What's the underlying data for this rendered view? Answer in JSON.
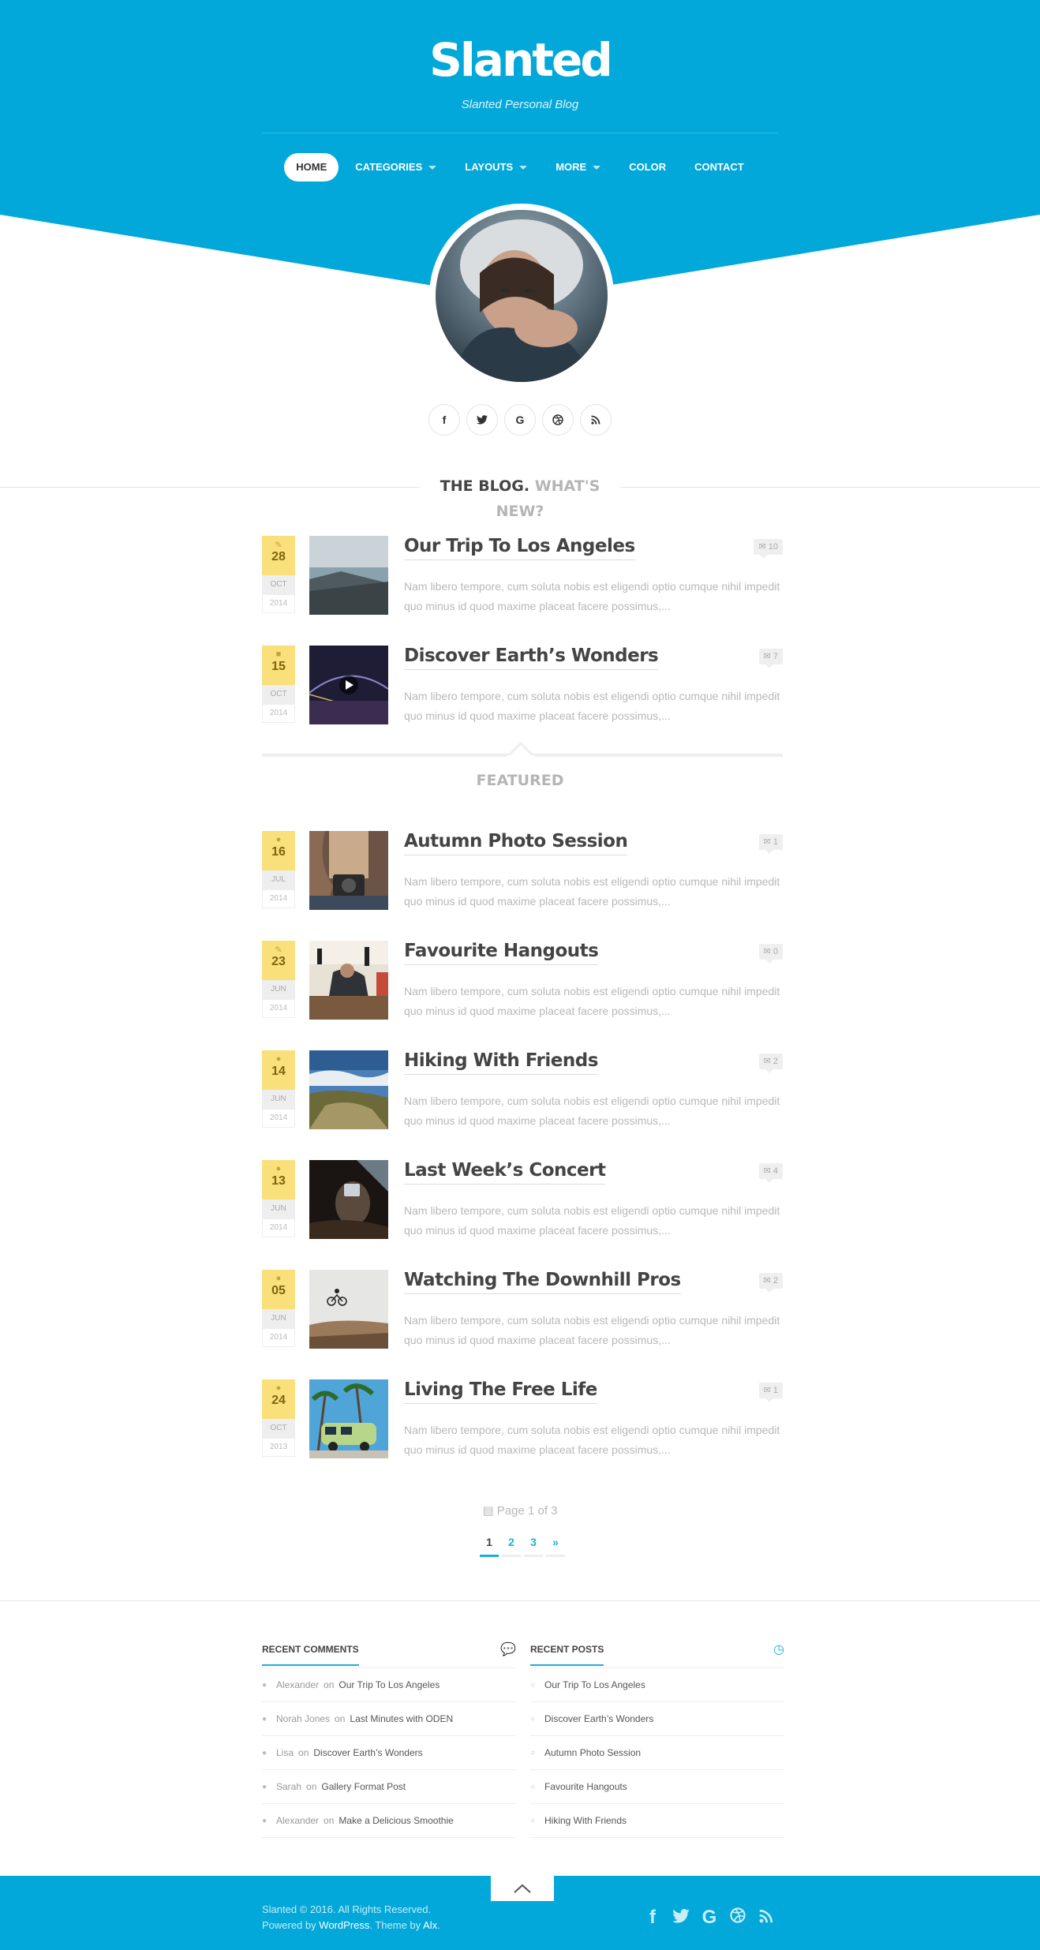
{
  "site": {
    "title": "Slanted",
    "description": "Slanted Personal Blog",
    "accent_color": "#02a8d9",
    "date_badge_color": "#f9e07a"
  },
  "nav": {
    "items": [
      {
        "label": "HOME",
        "active": true,
        "has_dropdown": false
      },
      {
        "label": "CATEGORIES",
        "active": false,
        "has_dropdown": true
      },
      {
        "label": "LAYOUTS",
        "active": false,
        "has_dropdown": true
      },
      {
        "label": "MORE",
        "active": false,
        "has_dropdown": true
      },
      {
        "label": "COLOR",
        "active": false,
        "has_dropdown": false
      },
      {
        "label": "CONTACT",
        "active": false,
        "has_dropdown": false
      }
    ]
  },
  "social": [
    "facebook-icon",
    "twitter-icon",
    "google-icon",
    "dribbble-icon",
    "rss-icon"
  ],
  "blog_heading": {
    "part1": "THE BLOG.",
    "part2": "WHAT'S NEW?"
  },
  "featured_label": "FEATURED",
  "posts": [
    {
      "day": "28",
      "month": "OCT",
      "year": "2014",
      "format_icon": "pencil-icon",
      "title": "Our Trip To Los Angeles",
      "comments": "10",
      "excerpt": "Nam libero tempore, cum soluta nobis est eligendi optio cumque nihil impedit quo minus id quod maxime placeat facere possimus,..."
    },
    {
      "day": "15",
      "month": "OCT",
      "year": "2014",
      "format_icon": "video-icon",
      "title": "Discover Earth’s Wonders",
      "comments": "7",
      "excerpt": "Nam libero tempore, cum soluta nobis est eligendi optio cumque nihil impedit quo minus id quod maxime placeat facere possimus,..."
    },
    {
      "day": "16",
      "month": "JUL",
      "year": "2014",
      "format_icon": "camera-icon",
      "title": "Autumn Photo Session",
      "comments": "1",
      "excerpt": "Nam libero tempore, cum soluta nobis est eligendi optio cumque nihil impedit quo minus id quod maxime placeat facere possimus,..."
    },
    {
      "day": "23",
      "month": "JUN",
      "year": "2014",
      "format_icon": "pencil-icon",
      "title": "Favourite Hangouts",
      "comments": "0",
      "excerpt": "Nam libero tempore, cum soluta nobis est eligendi optio cumque nihil impedit quo minus id quod maxime placeat facere possimus,..."
    },
    {
      "day": "14",
      "month": "JUN",
      "year": "2014",
      "format_icon": "camera-icon",
      "title": "Hiking With Friends",
      "comments": "2",
      "excerpt": "Nam libero tempore, cum soluta nobis est eligendi optio cumque nihil impedit quo minus id quod maxime placeat facere possimus,..."
    },
    {
      "day": "13",
      "month": "JUN",
      "year": "2014",
      "format_icon": "camera-icon",
      "title": "Last Week’s Concert",
      "comments": "4",
      "excerpt": "Nam libero tempore, cum soluta nobis est eligendi optio cumque nihil impedit quo minus id quod maxime placeat facere possimus,..."
    },
    {
      "day": "05",
      "month": "JUN",
      "year": "2014",
      "format_icon": "camera-icon",
      "title": "Watching The Downhill Pros",
      "comments": "2",
      "excerpt": "Nam libero tempore, cum soluta nobis est eligendi optio cumque nihil impedit quo minus id quod maxime placeat facere possimus,..."
    },
    {
      "day": "24",
      "month": "OCT",
      "year": "2013",
      "format_icon": "camera-icon",
      "title": "Living The Free Life",
      "comments": "1",
      "excerpt": "Nam libero tempore, cum soluta nobis est eligendi optio cumque nihil impedit quo minus id quod maxime placeat facere possimus,..."
    }
  ],
  "pagination": {
    "info": "Page 1 of 3",
    "pages": [
      "1",
      "2",
      "3",
      "»"
    ]
  },
  "recent_comments": {
    "title": "RECENT COMMENTS",
    "items": [
      {
        "author": "Alexander",
        "on": "on",
        "post": "Our Trip To Los Angeles"
      },
      {
        "author": "Norah Jones",
        "on": "on",
        "post": "Last Minutes with ODEN"
      },
      {
        "author": "Lisa",
        "on": "on",
        "post": "Discover Earth’s Wonders"
      },
      {
        "author": "Sarah",
        "on": "on",
        "post": "Gallery Format Post"
      },
      {
        "author": "Alexander",
        "on": "on",
        "post": "Make a Delicious Smoothie"
      }
    ]
  },
  "recent_posts": {
    "title": "RECENT POSTS",
    "items": [
      "Our Trip To Los Angeles",
      "Discover Earth’s Wonders",
      "Autumn Photo Session",
      "Favourite Hangouts",
      "Hiking With Friends"
    ]
  },
  "footer": {
    "copyright": "Slanted © 2016. All Rights Reserved.",
    "powered_prefix": "Powered by",
    "powered_link": "WordPress",
    "theme_text": ". Theme by",
    "theme_link": "Alx",
    "end": "."
  }
}
